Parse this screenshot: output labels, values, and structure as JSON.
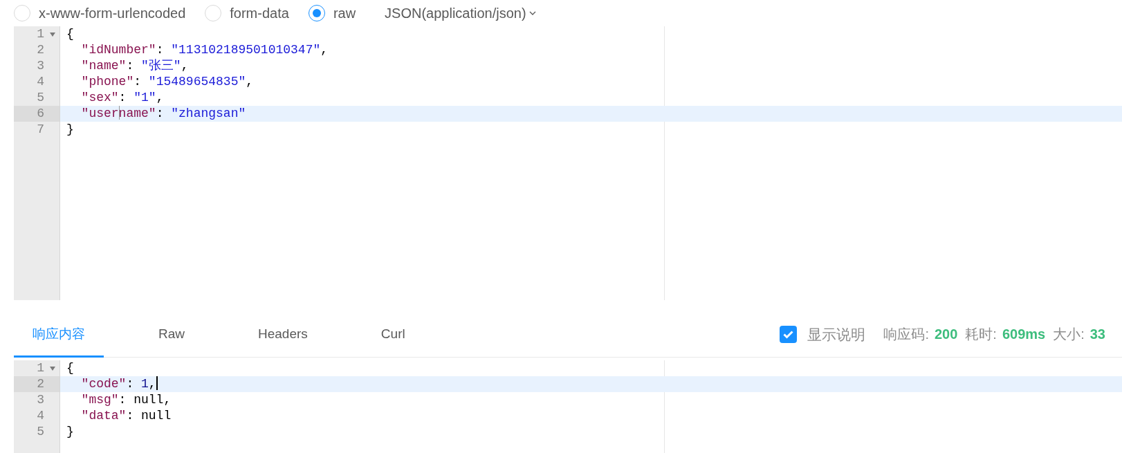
{
  "body_types": [
    {
      "label": "x-www-form-urlencoded",
      "selected": false
    },
    {
      "label": "form-data",
      "selected": false
    },
    {
      "label": "raw",
      "selected": true
    }
  ],
  "format_dropdown": {
    "label": "JSON(application/json)"
  },
  "request_editor": {
    "focused": false,
    "lines": [
      {
        "number": "1",
        "foldable": true,
        "active": false,
        "indented": false,
        "tokens": [
          {
            "kind": "punct",
            "text": "{"
          }
        ]
      },
      {
        "number": "2",
        "foldable": false,
        "active": false,
        "indented": true,
        "tokens": [
          {
            "kind": "key",
            "text": "\"idNumber\""
          },
          {
            "kind": "punct",
            "text": ": "
          },
          {
            "kind": "string",
            "text": "\"113102189501010347\""
          },
          {
            "kind": "punct",
            "text": ","
          }
        ]
      },
      {
        "number": "3",
        "foldable": false,
        "active": false,
        "indented": true,
        "tokens": [
          {
            "kind": "key",
            "text": "\"name\""
          },
          {
            "kind": "punct",
            "text": ": "
          },
          {
            "kind": "string",
            "text": "\"张三\""
          },
          {
            "kind": "punct",
            "text": ","
          }
        ]
      },
      {
        "number": "4",
        "foldable": false,
        "active": false,
        "indented": true,
        "tokens": [
          {
            "kind": "key",
            "text": "\"phone\""
          },
          {
            "kind": "punct",
            "text": ": "
          },
          {
            "kind": "string",
            "text": "\"15489654835\""
          },
          {
            "kind": "punct",
            "text": ","
          }
        ]
      },
      {
        "number": "5",
        "foldable": false,
        "active": false,
        "indented": true,
        "tokens": [
          {
            "kind": "key",
            "text": "\"sex\""
          },
          {
            "kind": "punct",
            "text": ": "
          },
          {
            "kind": "string",
            "text": "\"1\""
          },
          {
            "kind": "punct",
            "text": ","
          }
        ]
      },
      {
        "number": "6",
        "foldable": false,
        "active": true,
        "indented": true,
        "tokens": [
          {
            "kind": "key",
            "text": "\"user"
          },
          {
            "kind": "cursor"
          },
          {
            "kind": "key",
            "text": "name\""
          },
          {
            "kind": "punct",
            "text": ": "
          },
          {
            "kind": "string",
            "text": "\"zhangsan\""
          }
        ]
      },
      {
        "number": "7",
        "foldable": false,
        "active": false,
        "indented": false,
        "tokens": [
          {
            "kind": "punct",
            "text": "}"
          }
        ]
      }
    ]
  },
  "response_tabs": [
    {
      "label": "响应内容",
      "selected": true
    },
    {
      "label": "Raw",
      "selected": false
    },
    {
      "label": "Headers",
      "selected": false
    },
    {
      "label": "Curl",
      "selected": false
    }
  ],
  "show_description": {
    "label": "显示说明",
    "checked": true
  },
  "stats": [
    {
      "label": "响应码:",
      "value": "200"
    },
    {
      "label": "耗时:",
      "value": "609ms"
    },
    {
      "label": "大小:",
      "value": "33"
    }
  ],
  "response_editor": {
    "focused": true,
    "lines": [
      {
        "number": "1",
        "foldable": true,
        "active": false,
        "indented": false,
        "tokens": [
          {
            "kind": "punct",
            "text": "{"
          }
        ]
      },
      {
        "number": "2",
        "foldable": false,
        "active": true,
        "indented": true,
        "tokens": [
          {
            "kind": "key",
            "text": "\"code\""
          },
          {
            "kind": "punct",
            "text": ": "
          },
          {
            "kind": "number",
            "text": "1"
          },
          {
            "kind": "punct",
            "text": ","
          },
          {
            "kind": "cursor"
          }
        ]
      },
      {
        "number": "3",
        "foldable": false,
        "active": false,
        "indented": true,
        "tokens": [
          {
            "kind": "key",
            "text": "\"msg\""
          },
          {
            "kind": "punct",
            "text": ": "
          },
          {
            "kind": "literal",
            "text": "null"
          },
          {
            "kind": "punct",
            "text": ","
          }
        ]
      },
      {
        "number": "4",
        "foldable": false,
        "active": false,
        "indented": true,
        "tokens": [
          {
            "kind": "key",
            "text": "\"data\""
          },
          {
            "kind": "punct",
            "text": ": "
          },
          {
            "kind": "literal",
            "text": "null"
          }
        ]
      },
      {
        "number": "5",
        "foldable": false,
        "active": false,
        "indented": false,
        "tokens": [
          {
            "kind": "punct",
            "text": "}"
          }
        ]
      }
    ]
  }
}
